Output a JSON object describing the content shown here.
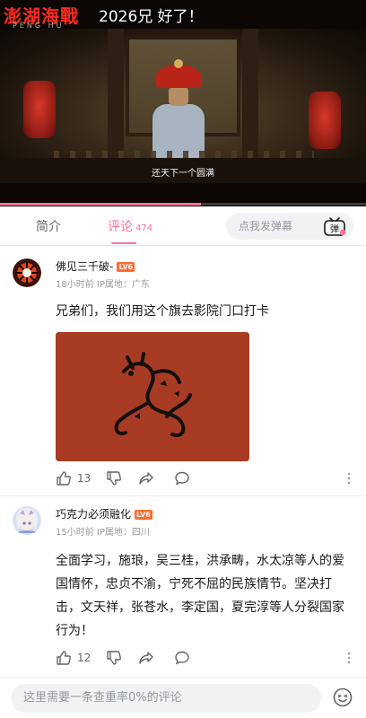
{
  "video": {
    "title": "澎湖海戰",
    "title_sub": "PENG HU",
    "danmaku": "2026兄 好了！",
    "subtitle": "还天下一个圆满",
    "progress": 0.55,
    "accent": "#fb7299"
  },
  "tabs": {
    "intro_label": "简介",
    "comments_label": "评论",
    "comments_count": "474",
    "danmaku_placeholder": "点我发弹幕",
    "danmaku_btn_label": "弹"
  },
  "comments": [
    {
      "username": "佛见三千破-",
      "level": "LV6",
      "meta": "18小时前 IP属地：广东",
      "text": "兄弟们，我们用这个旗去影院门口打卡",
      "has_image": true,
      "likes": "13"
    },
    {
      "username": "巧克力必须融化",
      "level": "LV6",
      "meta": "15小时前 IP属地：四川",
      "text": "全面学习，施琅，吴三桂，洪承畴，水太凉等人的爱国情怀，忠贞不渝，宁死不屈的民族情节。坚决打击，文天祥，张苍水，李定国，夏完淳等人分裂国家行为！",
      "has_image": false,
      "likes": "12"
    }
  ],
  "reply_bar": {
    "placeholder": "这里需要一条查重率0%的评论"
  },
  "icons": {
    "like": "thumb-up-icon",
    "dislike": "thumb-down-icon",
    "share": "share-icon",
    "reply": "reply-bubble-icon",
    "more": "more-vertical-icon",
    "emoji": "emoji-icon",
    "danmaku": "danmaku-tv-icon"
  }
}
